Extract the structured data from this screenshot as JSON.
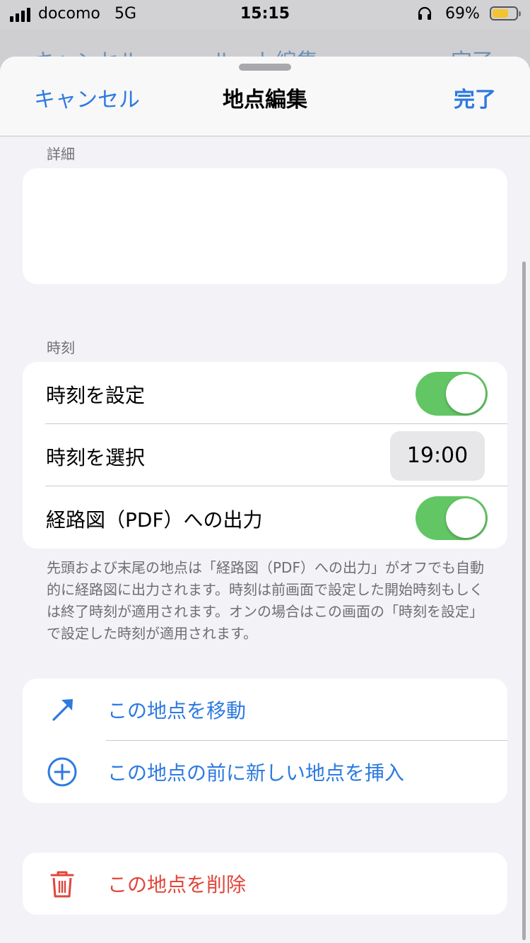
{
  "status_bar": {
    "carrier": "docomo",
    "network": "5G",
    "time": "15:15",
    "battery_percent": "69%",
    "battery_level": 0.69
  },
  "behind_nav": {
    "left": "キャンセル",
    "title": "ルート編集",
    "right": "完了"
  },
  "header": {
    "cancel_label": "キャンセル",
    "title": "地点編集",
    "done_label": "完了"
  },
  "details": {
    "section_title": "詳細",
    "text": ""
  },
  "time_section": {
    "section_title": "時刻",
    "set_time_label": "時刻を設定",
    "set_time_on": true,
    "select_time_label": "時刻を選択",
    "time_value": "19:00",
    "pdf_output_label": "経路図（PDF）への出力",
    "pdf_output_on": true,
    "footer": "先頭および末尾の地点は「経路図（PDF）への出力」がオフでも自動的に経路図に出力されます。時刻は前画面で設定した開始時刻もしくは終了時刻が適用されます。オンの場合はこの画面の「時刻を設定」で設定した時刻が適用されます。"
  },
  "actions": {
    "move_label": "この地点を移動",
    "insert_label": "この地点の前に新しい地点を挿入",
    "delete_label": "この地点を削除"
  },
  "colors": {
    "accent": "#2d7ae0",
    "destructive": "#e0463a",
    "toggle_on": "#63c665"
  }
}
